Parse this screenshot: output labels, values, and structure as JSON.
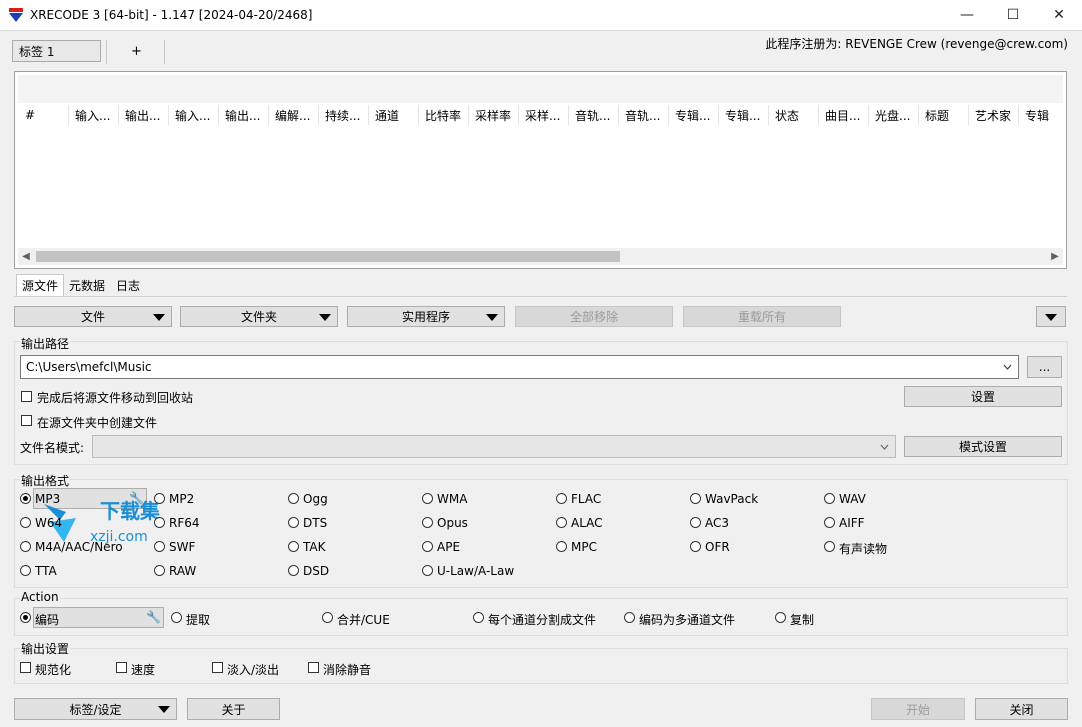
{
  "window": {
    "title": "XRECODE 3 [64-bit] - 1.147 [2024-04-20/2468]",
    "minimize": "—",
    "maximize": "☐",
    "close": "✕"
  },
  "registration": "此程序注册为: REVENGE Crew (revenge@crew.com)",
  "top_tabs": {
    "tab1": "标签 1",
    "add": "+"
  },
  "file_list": {
    "columns": [
      "#",
      "输入...",
      "输出...",
      "输入...",
      "输出...",
      "编解...",
      "持续...",
      "通道",
      "比特率",
      "采样率",
      "采样...",
      "音轨...",
      "音轨...",
      "专辑...",
      "专辑...",
      "状态",
      "曲目...",
      "光盘...",
      "标题",
      "艺术家",
      "专辑"
    ],
    "scroll_left": "◀",
    "scroll_right": "▶"
  },
  "lower_tabs": [
    "源文件",
    "元数据",
    "日志"
  ],
  "toolbar": {
    "file": "文件",
    "folder": "文件夹",
    "utility": "实用程序",
    "remove_all": "全部移除",
    "reload_all": "重载所有"
  },
  "output_path": {
    "label": "输出路径",
    "value": "C:\\Users\\mefcl\\Music",
    "browse": "...",
    "move_to_recycle": "完成后将源文件移动到回收站",
    "create_in_source": "在源文件夹中创建文件",
    "settings": "设置",
    "filename_mode_label": "文件名模式:",
    "mode_settings": "模式设置"
  },
  "output_format": {
    "label": "输出格式",
    "selected": "MP3",
    "rows": [
      [
        "MP3",
        "MP2",
        "Ogg",
        "WMA",
        "FLAC",
        "WavPack",
        "WAV"
      ],
      [
        "W64",
        "RF64",
        "DTS",
        "Opus",
        "ALAC",
        "AC3",
        "AIFF"
      ],
      [
        "M4A/AAC/Nero",
        "SWF",
        "TAK",
        "APE",
        "MPC",
        "OFR",
        "有声读物"
      ],
      [
        "TTA",
        "RAW",
        "DSD",
        "U-Law/A-Law"
      ]
    ]
  },
  "action": {
    "label": "Action",
    "items": [
      "编码",
      "提取",
      "合并/CUE",
      "每个通道分割成文件",
      "编码为多通道文件",
      "复制"
    ]
  },
  "output_settings": {
    "label": "输出设置",
    "items": [
      "规范化",
      "速度",
      "淡入/淡出",
      "消除静音"
    ]
  },
  "bottom": {
    "tags_settings": "标签/设定",
    "about": "关于",
    "start": "开始",
    "close": "关闭"
  },
  "watermark": {
    "text1": "下载集",
    "text2": "xzji.com"
  },
  "colors": {
    "window_bg": "#f0f0f0",
    "disabled_text": "#9a9a9a",
    "watermark_blue": "#1a8fd6"
  }
}
